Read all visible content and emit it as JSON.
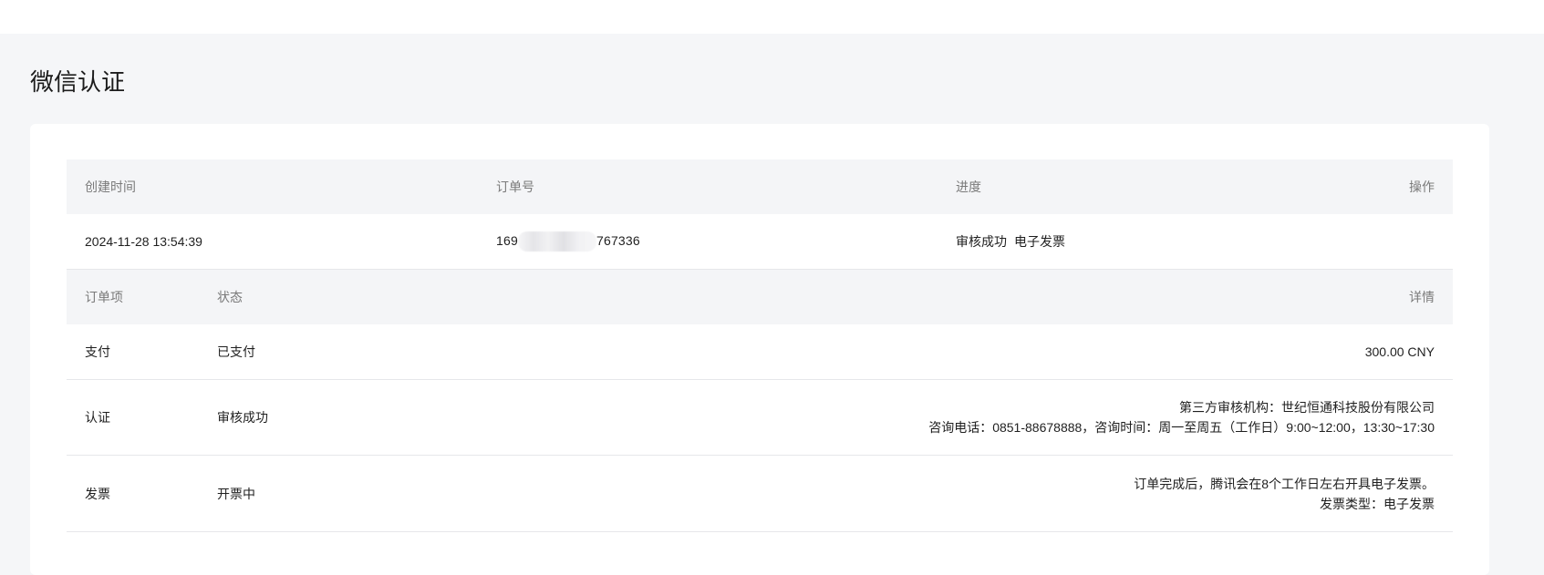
{
  "page": {
    "title": "微信认证"
  },
  "order_table": {
    "headers": {
      "created_time": "创建时间",
      "order_no": "订单号",
      "progress": "进度",
      "operation": "操作"
    },
    "row": {
      "created_time": "2024-11-28 13:54:39",
      "order_no_prefix": "169",
      "order_no_suffix": "767336",
      "progress": [
        "审核成功",
        "电子发票"
      ],
      "operation": ""
    }
  },
  "items_table": {
    "headers": {
      "item": "订单项",
      "status": "状态",
      "detail": "详情"
    },
    "rows": [
      {
        "item": "支付",
        "status": "已支付",
        "detail_lines": [
          "300.00 CNY"
        ]
      },
      {
        "item": "认证",
        "status": "审核成功",
        "detail_lines": [
          "第三方审核机构：世纪恒通科技股份有限公司",
          "咨询电话：0851-88678888，咨询时间：周一至周五（工作日）9:00~12:00，13:30~17:30"
        ]
      },
      {
        "item": "发票",
        "status": "开票中",
        "detail_lines": [
          "订单完成后，腾讯会在8个工作日左右开具电子发票。",
          "发票类型：电子发票"
        ]
      }
    ]
  }
}
